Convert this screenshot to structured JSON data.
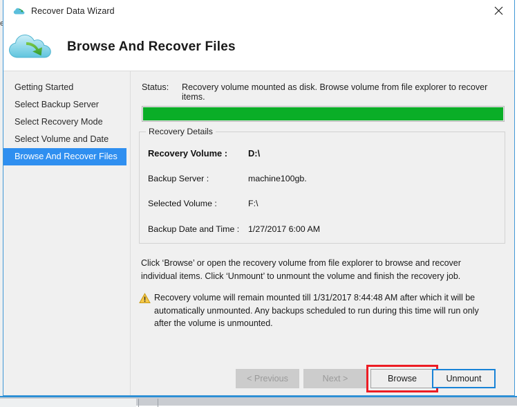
{
  "window": {
    "title": "Recover Data Wizard",
    "title_icon": "cloud-icon",
    "close_icon": "close-icon",
    "header_title": "Browse And Recover Files",
    "header_icon": "cloud-recover-icon"
  },
  "background": {
    "left_sliver_text": "e"
  },
  "sidebar": {
    "items": [
      {
        "label": "Getting Started",
        "active": false
      },
      {
        "label": "Select Backup Server",
        "active": false
      },
      {
        "label": "Select Recovery Mode",
        "active": false
      },
      {
        "label": "Select Volume and Date",
        "active": false
      },
      {
        "label": "Browse And Recover Files",
        "active": true
      }
    ]
  },
  "status": {
    "label": "Status:",
    "text": "Recovery volume mounted as disk. Browse volume from file explorer to recover items."
  },
  "progress": {
    "percent": 100,
    "color": "#0aae27"
  },
  "recovery_details": {
    "title": "Recovery Details",
    "rows": [
      {
        "key": "Recovery Volume :",
        "value": "D:\\",
        "strong": true
      },
      {
        "key": "Backup Server :",
        "value": "machine100gb.",
        "strong": false
      },
      {
        "key": "Selected Volume :",
        "value": "F:\\",
        "strong": false
      },
      {
        "key": "Backup Date and Time :",
        "value": "1/27/2017 6:00 AM",
        "strong": false
      }
    ]
  },
  "instructions": {
    "text": "Click ‘Browse’ or open the recovery volume from file explorer to browse and recover individual items. Click ‘Unmount’ to unmount the volume and finish the recovery job."
  },
  "warning": {
    "icon": "warning-triangle-icon",
    "text": "Recovery volume will remain mounted till 1/31/2017 8:44:48 AM after which it will be automatically unmounted. Any backups scheduled to run during this time will run only after the volume is unmounted."
  },
  "footer": {
    "previous_label": "< Previous",
    "next_label": "Next >",
    "browse_label": "Browse",
    "unmount_label": "Unmount"
  },
  "colors": {
    "window_border": "#3f97d6",
    "sidebar_active": "#2f8ff0",
    "progress_green": "#0aae27",
    "highlight_red": "#ed1c24",
    "focus_blue": "#1883d7",
    "warning_yellow": "#f5c518"
  }
}
